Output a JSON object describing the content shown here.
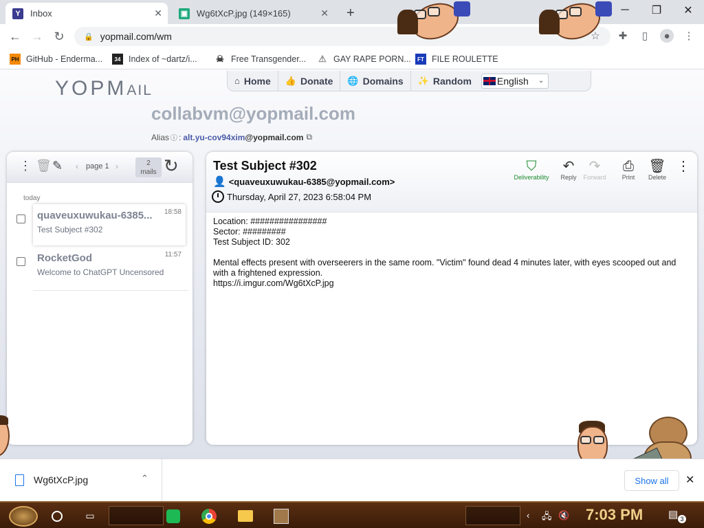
{
  "browser": {
    "tabs": [
      {
        "title": "Inbox",
        "favicon": "yopmail-y-icon",
        "active": true
      },
      {
        "title": "Wg6tXcP.jpg (149×165)",
        "favicon": "image-icon",
        "active": false
      }
    ],
    "new_tab": "+",
    "url": "yopmail.com/wm",
    "bookmarks": [
      {
        "label": "GitHub - Enderma...",
        "icon_text": "PH",
        "color": "#f58a07"
      },
      {
        "label": "Index of ~dartz/i...",
        "icon_text": "34",
        "color": "#222222"
      },
      {
        "label": "Free Transgender...",
        "icon_text": "☠",
        "color": "#555555"
      },
      {
        "label": "GAY RAPE PORN...",
        "icon_text": "⚠",
        "color": "#999999"
      },
      {
        "label": "FILE ROULETTE",
        "icon_text": "FT",
        "color": "#1a3bb8"
      }
    ]
  },
  "yopmail": {
    "logo_big": "YOPM",
    "logo_small": "AIL",
    "nav": [
      {
        "label": "Home",
        "icon": "home-icon",
        "glyph": "⌂"
      },
      {
        "label": "Donate",
        "icon": "thumbs-up-icon",
        "glyph": "👍"
      },
      {
        "label": "Domains",
        "icon": "globe-icon",
        "glyph": "🌐"
      },
      {
        "label": "Random",
        "icon": "magic-wand-icon",
        "glyph": "✨"
      }
    ],
    "language": "English",
    "email": "collabvm@yopmail.com",
    "alias_label": "Alias",
    "alias_value": "alt.yu-cov94xim",
    "alias_domain": "@yopmail.com"
  },
  "inbox": {
    "page_label": "page 1",
    "mails_count": "2",
    "mails_label": "mails",
    "group_label": "today",
    "messages": [
      {
        "sender": "quaveuxuwukau-6385...",
        "subject": "Test Subject #302",
        "time": "18:58",
        "selected": true
      },
      {
        "sender": "RocketGod",
        "subject": "Welcome to ChatGPT Uncensored",
        "time": "11:57",
        "selected": false
      }
    ]
  },
  "message": {
    "subject": "Test Subject #302",
    "from": "<quaveuxuwukau-6385@yopmail.com>",
    "date": "Thursday, April 27, 2023 6:58:04 PM",
    "actions": [
      {
        "label": "Deliverability",
        "icon": "shield-check-icon"
      },
      {
        "label": "Reply",
        "icon": "reply-icon"
      },
      {
        "label": "Forward",
        "icon": "forward-icon"
      },
      {
        "label": "Print",
        "icon": "printer-icon"
      },
      {
        "label": "Delete",
        "icon": "trash-icon"
      }
    ],
    "body": [
      "Location: ################",
      "Sector: #########",
      "Test Subject ID: 302",
      "",
      "Mental effects present with overseerers in the same room. \"Victim\" found dead 4 minutes later, with eyes scooped out and with a frightened expression.",
      "https://i.imgur.com/Wg6tXcP.jpg"
    ]
  },
  "downloads": {
    "filename": "Wg6tXcP.jpg",
    "show_all": "Show all"
  },
  "taskbar": {
    "clock": "7:03 PM",
    "notification_count": "3"
  }
}
